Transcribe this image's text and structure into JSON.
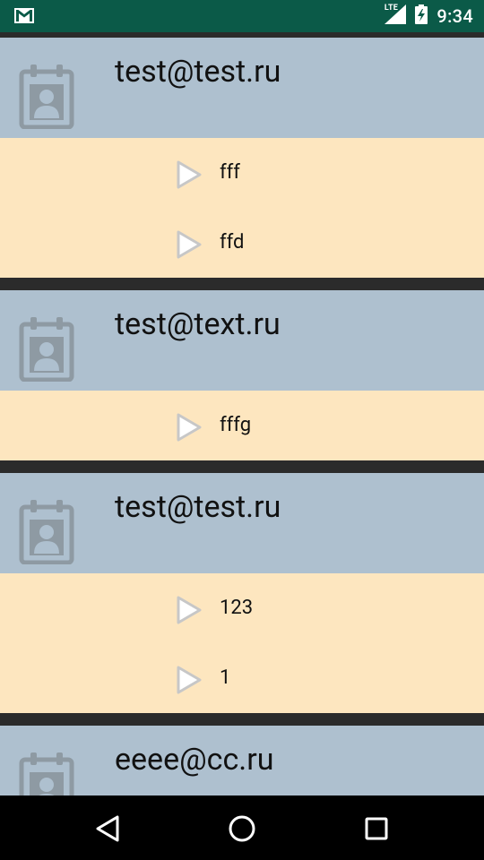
{
  "status_bar": {
    "time": "9:34",
    "network_label": "LTE",
    "icons": [
      "gmail-icon",
      "signal-icon",
      "battery-charging-icon"
    ]
  },
  "groups": [
    {
      "email": "test@test.ru",
      "children": [
        "fff",
        "ffd"
      ]
    },
    {
      "email": "test@text.ru",
      "children": [
        "fffg"
      ]
    },
    {
      "email": "test@test.ru",
      "children": [
        "123",
        "1"
      ]
    },
    {
      "email": "eeee@cc.ru",
      "children": []
    }
  ],
  "nav_bar": {
    "buttons": [
      "back-button",
      "home-button",
      "recents-button"
    ]
  },
  "colors": {
    "status_bar": "#0b5a48",
    "header": "#aec0cf",
    "child": "#fde6bf",
    "divider": "#2b2b2b"
  }
}
